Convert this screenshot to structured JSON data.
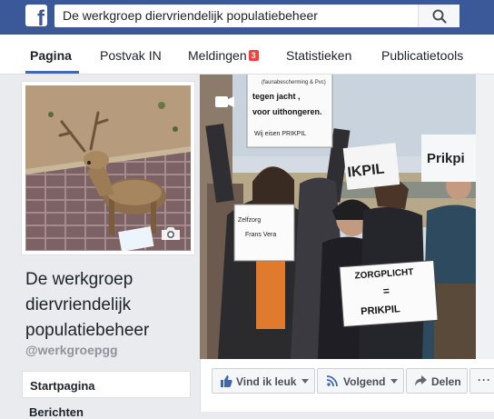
{
  "header": {
    "logo": "f",
    "search_value": "De werkgroep diervriendelijk populatiebeheer",
    "search_icon": "magnifier-icon"
  },
  "tabs": [
    {
      "label": "Pagina",
      "active": true
    },
    {
      "label": "Postvak IN"
    },
    {
      "label": "Meldingen",
      "badge": "3"
    },
    {
      "label": "Statistieken"
    },
    {
      "label": "Publicatietools"
    }
  ],
  "page": {
    "name": "De werkgroep diervriendelijk populatiebeheer",
    "handle": "@werkgroepgg"
  },
  "sidebar": {
    "items": [
      {
        "label": "Startpagina"
      },
      {
        "label": "Berichten"
      }
    ]
  },
  "cover": {
    "sign_top_line1": "(faunabescherming & Pvc)",
    "sign_top_line2": "tegen jacht ,",
    "sign_top_line3": "voor uithongeren.",
    "sign_top_line4": "Wij eisen PRIKPIL",
    "sign_center_line1": "Zelfzorg",
    "sign_center_line2": "Frans Vera",
    "sign_pikpil": "IKPIL",
    "sign_prikpi": "Prikpi",
    "sign_bottom_line1": "ZORGPLICHT",
    "sign_bottom_line2": "=",
    "sign_bottom_line3": "PRIKPIL"
  },
  "actions": {
    "like_label": "Vind ik leuk",
    "follow_label": "Volgend",
    "share_label": "Delen",
    "more_label": "···"
  },
  "colors": {
    "brand": "#3b5998",
    "badge": "#fa3e3e",
    "tab_underline": "#4267b2"
  }
}
